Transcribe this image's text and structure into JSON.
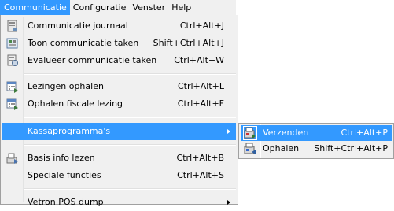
{
  "menubar": {
    "items": [
      {
        "label": "Communicatie",
        "active": true
      },
      {
        "label": "Configuratie"
      },
      {
        "label": "Venster"
      },
      {
        "label": "Help"
      }
    ]
  },
  "menu": {
    "items": [
      {
        "label": "Communicatie journaal",
        "shortcut": "Ctrl+Alt+J",
        "icon": "journal-icon"
      },
      {
        "label": "Toon communicatie taken",
        "shortcut": "Shift+Ctrl+Alt+J",
        "icon": "tasks-icon"
      },
      {
        "label": "Evalueer communicatie taken",
        "shortcut": "Ctrl+Alt+W",
        "icon": "evaluate-icon"
      },
      {
        "label": "Lezingen ophalen",
        "shortcut": "Ctrl+Alt+L",
        "icon": "calendar-icon"
      },
      {
        "label": "Ophalen fiscale lezing",
        "shortcut": "Ctrl+Alt+F",
        "icon": "calendar-icon"
      },
      {
        "label": "Kassaprogramma's",
        "shortcut": "",
        "submenu": true
      },
      {
        "label": "Basis info lezen",
        "shortcut": "Ctrl+Alt+B",
        "icon": "read-icon"
      },
      {
        "label": "Speciale functies",
        "shortcut": "Ctrl+Alt+S"
      },
      {
        "label": "Vetron POS dump",
        "shortcut": "",
        "submenu": true
      }
    ]
  },
  "submenu": {
    "items": [
      {
        "label": "Verzenden",
        "shortcut": "Ctrl+Alt+P",
        "icon": "send-icon"
      },
      {
        "label": "Ophalen",
        "shortcut": "Shift+Ctrl+Alt+P",
        "icon": "fetch-icon"
      }
    ]
  },
  "colors": {
    "highlight": "#3399ff",
    "menu_bg": "#f0f0f0"
  }
}
